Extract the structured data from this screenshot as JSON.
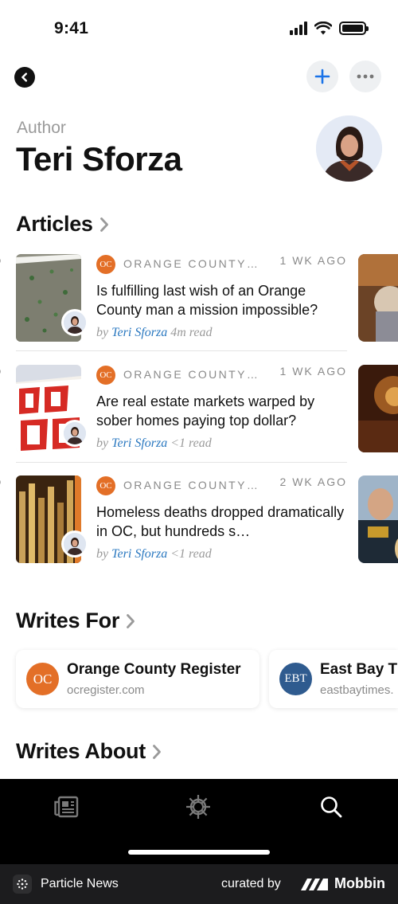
{
  "status_bar": {
    "time": "9:41"
  },
  "header": {
    "author_label": "Author",
    "author_name": "Teri Sforza"
  },
  "sections": {
    "articles": "Articles",
    "writes_for": "Writes For",
    "writes_about": "Writes About"
  },
  "articles": [
    {
      "source": "ORANGE COUNTY…",
      "source_icon": "OC",
      "time": "1 WK AGO",
      "headline": "Is fulfilling last wish of an Orange County man a mission impossible?",
      "by": "by",
      "author": "Teri Sforza",
      "read": "4m read"
    },
    {
      "source": "ORANGE COUNTY…",
      "source_icon": "OC",
      "time": "1 WK AGO",
      "headline": "Are real estate markets warped by sober homes paying top dollar?",
      "by": "by",
      "author": "Teri Sforza",
      "read": "<1 read"
    },
    {
      "source": "ORANGE COUNTY…",
      "source_icon": "OC",
      "time": "2 WK AGO",
      "headline": "Homeless deaths dropped dramatically in OC, but hundreds s…",
      "by": "by",
      "author": "Teri Sforza",
      "read": "<1 read"
    }
  ],
  "publications": [
    {
      "name": "Orange County Register",
      "url": "ocregister.com",
      "logo": "OC",
      "color": "#e36f27"
    },
    {
      "name": "East Bay T",
      "url": "eastbaytimes.",
      "logo": "EBT",
      "color": "#2f5b8f"
    }
  ],
  "tabs": [
    {
      "icon": "newspaper-icon"
    },
    {
      "icon": "helm-icon"
    },
    {
      "icon": "search-icon"
    }
  ],
  "footer": {
    "app_name": "Particle News",
    "curated_by": "curated by",
    "brand": "Mobbin"
  },
  "colors": {
    "accent_blue": "#2a78c0",
    "oc_orange": "#e36f27",
    "tabbar_bg": "#000000"
  }
}
